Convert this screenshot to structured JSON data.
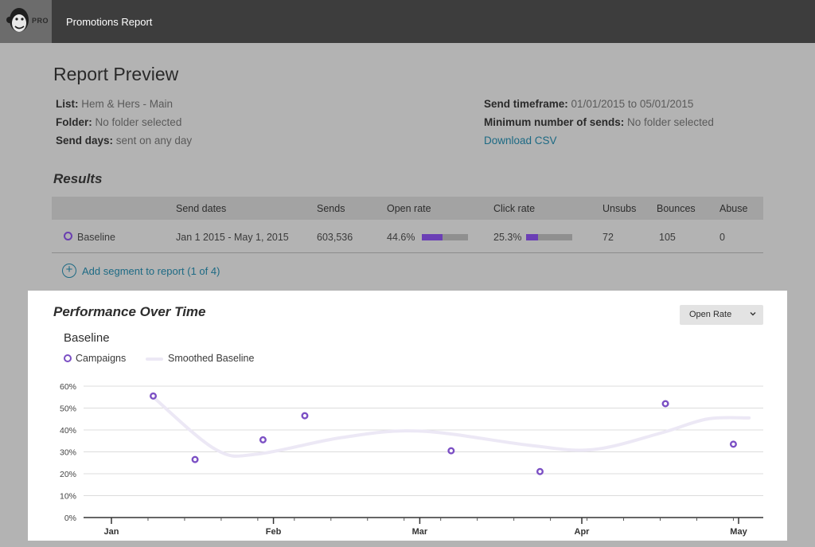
{
  "app": {
    "badge": "PRO",
    "title": "Promotions Report"
  },
  "report": {
    "title": "Report Preview",
    "list_label": "List:",
    "list_value": "Hem & Hers - Main",
    "folder_label": "Folder:",
    "folder_value": "No folder selected",
    "senddays_label": "Send days:",
    "senddays_value": "sent on any day",
    "timeframe_label": "Send timeframe:",
    "timeframe_value": "01/01/2015 to 05/01/2015",
    "minsends_label": "Minimum number of sends:",
    "minsends_value": "No folder selected",
    "download_label": "Download CSV"
  },
  "results": {
    "title": "Results",
    "headers": [
      "Send dates",
      "Sends",
      "Open rate",
      "Click rate",
      "Unsubs",
      "Bounces",
      "Abuse"
    ],
    "row": {
      "name": "Baseline",
      "send_dates": "Jan 1 2015 - May 1, 2015",
      "sends": "603,536",
      "open_rate": "44.6%",
      "open_rate_fraction": 0.446,
      "click_rate": "25.3%",
      "click_rate_fraction": 0.253,
      "unsubs": "72",
      "bounces": "105",
      "abuse": "0"
    },
    "add_segment": "Add segment to report (1 of 4)"
  },
  "performance": {
    "title": "Performance Over Time",
    "dropdown_value": "Open Rate",
    "series_title": "Baseline",
    "legend_campaigns": "Campaigns",
    "legend_smoothed": "Smoothed Baseline"
  },
  "colors": {
    "accent": "#7b4fc4",
    "link": "#1d6a84",
    "smooth": "#ece8f5"
  },
  "chart_data": {
    "type": "scatter",
    "xlabel": "",
    "ylabel": "",
    "x_ticks": [
      "Jan",
      "Feb",
      "Mar",
      "Apr",
      "May"
    ],
    "x_tick_dates": [
      "2015-01-01",
      "2015-02-01",
      "2015-03-01",
      "2015-04-01",
      "2015-05-01"
    ],
    "y_ticks": [
      "0%",
      "10%",
      "20%",
      "30%",
      "40%",
      "50%",
      "60%"
    ],
    "ylim": [
      0,
      60
    ],
    "grid": true,
    "legend_position": "top-left",
    "series": [
      {
        "name": "Campaigns",
        "points": [
          {
            "x": "2015-01-09",
            "y": 55.5
          },
          {
            "x": "2015-01-17",
            "y": 26.5
          },
          {
            "x": "2015-01-30",
            "y": 35.5
          },
          {
            "x": "2015-02-07",
            "y": 46.5
          },
          {
            "x": "2015-03-07",
            "y": 30.5
          },
          {
            "x": "2015-03-24",
            "y": 21.0
          },
          {
            "x": "2015-04-17",
            "y": 52.0
          },
          {
            "x": "2015-04-30",
            "y": 33.5
          }
        ]
      },
      {
        "name": "Smoothed Baseline",
        "points": [
          {
            "x": "2015-01-09",
            "y": 55.0
          },
          {
            "x": "2015-01-21",
            "y": 31.0
          },
          {
            "x": "2015-01-29",
            "y": 29.0
          },
          {
            "x": "2015-02-14",
            "y": 36.5
          },
          {
            "x": "2015-03-01",
            "y": 39.5
          },
          {
            "x": "2015-03-22",
            "y": 33.0
          },
          {
            "x": "2015-04-03",
            "y": 31.0
          },
          {
            "x": "2015-04-16",
            "y": 38.5
          },
          {
            "x": "2015-04-25",
            "y": 45.0
          },
          {
            "x": "2015-05-03",
            "y": 45.5
          }
        ]
      }
    ]
  }
}
